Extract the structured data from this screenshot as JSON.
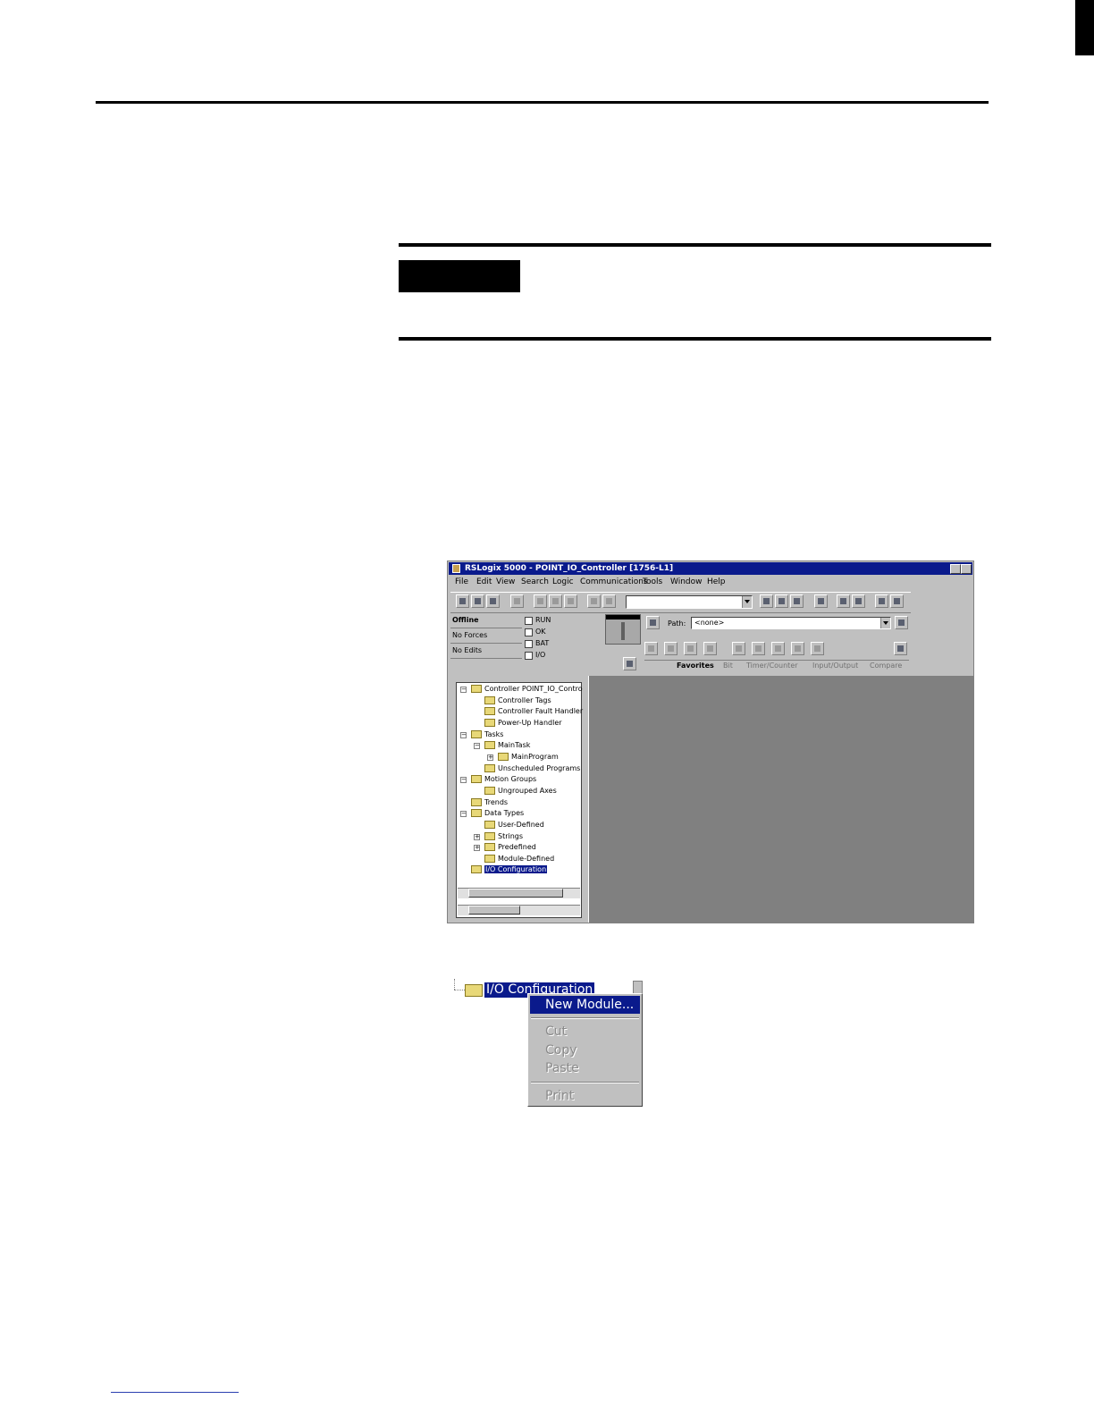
{
  "window": {
    "title": "RSLogix 5000 - POINT_IO_Controller [1756-L1]",
    "menu": [
      "File",
      "Edit",
      "View",
      "Search",
      "Logic",
      "Communications",
      "Tools",
      "Window",
      "Help"
    ],
    "status": {
      "mode": "Offline",
      "forces": "No Forces",
      "edits": "No Edits"
    },
    "indicators": [
      "RUN",
      "OK",
      "BAT",
      "I/O"
    ],
    "path_label": "Path:",
    "path_value": "<none>",
    "tabs": [
      "Favorites",
      "Bit",
      "Timer/Counter",
      "Input/Output",
      "Compare"
    ],
    "tree": [
      {
        "label": "Controller POINT_IO_Contro",
        "expander": "−"
      },
      {
        "label": "Controller Tags"
      },
      {
        "label": "Controller Fault Handler"
      },
      {
        "label": "Power-Up Handler"
      },
      {
        "label": "Tasks",
        "expander": "−"
      },
      {
        "label": "MainTask",
        "expander": "−"
      },
      {
        "label": "MainProgram",
        "expander": "+"
      },
      {
        "label": "Unscheduled Programs"
      },
      {
        "label": "Motion Groups",
        "expander": "−"
      },
      {
        "label": "Ungrouped Axes"
      },
      {
        "label": "Trends"
      },
      {
        "label": "Data Types",
        "expander": "−"
      },
      {
        "label": "User-Defined"
      },
      {
        "label": "Strings",
        "expander": "+"
      },
      {
        "label": "Predefined",
        "expander": "+"
      },
      {
        "label": "Module-Defined"
      },
      {
        "label": "I/O Configuration",
        "selected": true
      }
    ]
  },
  "context": {
    "node_label": "I/O Configuration",
    "menu": [
      {
        "label": "New Module...",
        "state": "highlighted"
      },
      {
        "label": "Cut",
        "state": "disabled"
      },
      {
        "label": "Copy",
        "state": "disabled"
      },
      {
        "label": "Paste",
        "state": "disabled"
      },
      {
        "label": "Print",
        "state": "disabled"
      }
    ]
  },
  "colors": {
    "titlebar": "#0a1a8c",
    "face": "#c0c0c0",
    "workspace": "#808080"
  }
}
